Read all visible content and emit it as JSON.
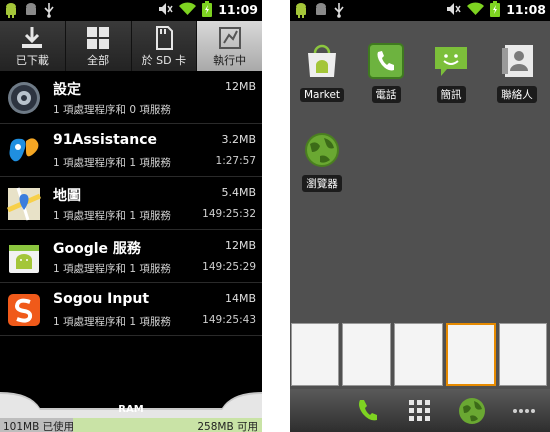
{
  "colors": {
    "ram_free": "#c9e3a6",
    "ram_used": "#bdbdbd",
    "home_bg": "#505050",
    "active_tab": "#c4c4c4"
  },
  "left": {
    "status": {
      "time": "11:09",
      "icons": [
        "android-icon",
        "android-icon",
        "usb-icon",
        "mute-icon",
        "wifi-icon",
        "battery-icon"
      ]
    },
    "tabs": [
      {
        "label": "已下載",
        "icon": "download-icon",
        "active": false
      },
      {
        "label": "全部",
        "icon": "grid-icon",
        "active": false
      },
      {
        "label": "於 SD 卡",
        "icon": "sdcard-icon",
        "active": false
      },
      {
        "label": "執行中",
        "icon": "running-icon",
        "active": true
      }
    ],
    "apps": [
      {
        "name": "設定",
        "desc": "1 項處理程序和 0 項服務",
        "size": "12MB",
        "time": "",
        "icon": "settings-icon"
      },
      {
        "name": "91Assistance",
        "desc": "1 項處理程序和 1 項服務",
        "size": "3.2MB",
        "time": "1:27:57",
        "icon": "assistance-icon"
      },
      {
        "name": "地圖",
        "desc": "1 項處理程序和 1 項服務",
        "size": "5.4MB",
        "time": "149:25:32",
        "icon": "maps-icon"
      },
      {
        "name": "Google 服務",
        "desc": "1 項處理程序和 1 項服務",
        "size": "12MB",
        "time": "149:25:29",
        "icon": "google-services-icon"
      },
      {
        "name": "Sogou Input",
        "desc": "1 項處理程序和 1 項服務",
        "size": "14MB",
        "time": "149:25:43",
        "icon": "sogou-icon"
      }
    ],
    "ram": {
      "label": "RAM",
      "used": "101MB 已使用",
      "free": "258MB 可用",
      "used_fraction": 0.28
    }
  },
  "right": {
    "status": {
      "time": "11:08",
      "icons": [
        "android-icon",
        "android-icon",
        "usb-icon",
        "mute-icon",
        "wifi-icon",
        "battery-icon"
      ]
    },
    "home_icons": [
      {
        "label": "Market",
        "icon": "market-icon"
      },
      {
        "label": "電話",
        "icon": "phone-icon"
      },
      {
        "label": "簡訊",
        "icon": "sms-icon"
      },
      {
        "label": "聯絡人",
        "icon": "contacts-icon"
      },
      {
        "label": "瀏覽器",
        "icon": "browser-icon"
      }
    ],
    "thumbnails": {
      "count": 5,
      "selected": 3
    },
    "dock": [
      "phone-icon",
      "app-drawer-icon",
      "browser-icon",
      "more-icon"
    ]
  }
}
